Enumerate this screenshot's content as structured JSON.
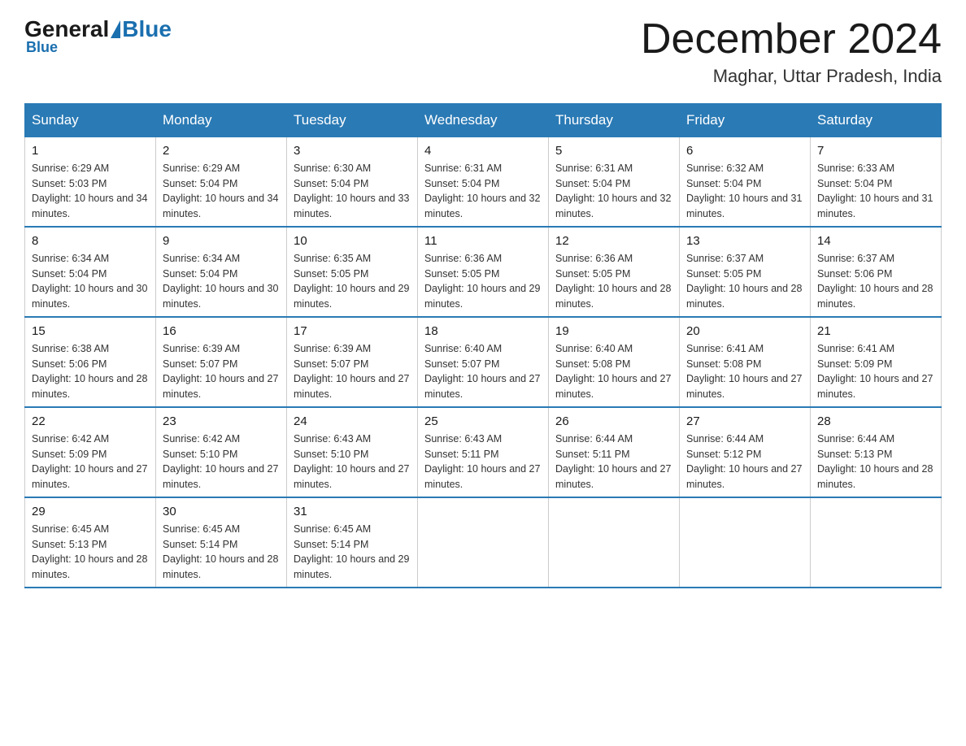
{
  "header": {
    "logo_general": "General",
    "logo_blue": "Blue",
    "month_title": "December 2024",
    "location": "Maghar, Uttar Pradesh, India"
  },
  "days_of_week": [
    "Sunday",
    "Monday",
    "Tuesday",
    "Wednesday",
    "Thursday",
    "Friday",
    "Saturday"
  ],
  "weeks": [
    [
      {
        "day": "1",
        "sunrise": "6:29 AM",
        "sunset": "5:03 PM",
        "daylight": "10 hours and 34 minutes."
      },
      {
        "day": "2",
        "sunrise": "6:29 AM",
        "sunset": "5:04 PM",
        "daylight": "10 hours and 34 minutes."
      },
      {
        "day": "3",
        "sunrise": "6:30 AM",
        "sunset": "5:04 PM",
        "daylight": "10 hours and 33 minutes."
      },
      {
        "day": "4",
        "sunrise": "6:31 AM",
        "sunset": "5:04 PM",
        "daylight": "10 hours and 32 minutes."
      },
      {
        "day": "5",
        "sunrise": "6:31 AM",
        "sunset": "5:04 PM",
        "daylight": "10 hours and 32 minutes."
      },
      {
        "day": "6",
        "sunrise": "6:32 AM",
        "sunset": "5:04 PM",
        "daylight": "10 hours and 31 minutes."
      },
      {
        "day": "7",
        "sunrise": "6:33 AM",
        "sunset": "5:04 PM",
        "daylight": "10 hours and 31 minutes."
      }
    ],
    [
      {
        "day": "8",
        "sunrise": "6:34 AM",
        "sunset": "5:04 PM",
        "daylight": "10 hours and 30 minutes."
      },
      {
        "day": "9",
        "sunrise": "6:34 AM",
        "sunset": "5:04 PM",
        "daylight": "10 hours and 30 minutes."
      },
      {
        "day": "10",
        "sunrise": "6:35 AM",
        "sunset": "5:05 PM",
        "daylight": "10 hours and 29 minutes."
      },
      {
        "day": "11",
        "sunrise": "6:36 AM",
        "sunset": "5:05 PM",
        "daylight": "10 hours and 29 minutes."
      },
      {
        "day": "12",
        "sunrise": "6:36 AM",
        "sunset": "5:05 PM",
        "daylight": "10 hours and 28 minutes."
      },
      {
        "day": "13",
        "sunrise": "6:37 AM",
        "sunset": "5:05 PM",
        "daylight": "10 hours and 28 minutes."
      },
      {
        "day": "14",
        "sunrise": "6:37 AM",
        "sunset": "5:06 PM",
        "daylight": "10 hours and 28 minutes."
      }
    ],
    [
      {
        "day": "15",
        "sunrise": "6:38 AM",
        "sunset": "5:06 PM",
        "daylight": "10 hours and 28 minutes."
      },
      {
        "day": "16",
        "sunrise": "6:39 AM",
        "sunset": "5:07 PM",
        "daylight": "10 hours and 27 minutes."
      },
      {
        "day": "17",
        "sunrise": "6:39 AM",
        "sunset": "5:07 PM",
        "daylight": "10 hours and 27 minutes."
      },
      {
        "day": "18",
        "sunrise": "6:40 AM",
        "sunset": "5:07 PM",
        "daylight": "10 hours and 27 minutes."
      },
      {
        "day": "19",
        "sunrise": "6:40 AM",
        "sunset": "5:08 PM",
        "daylight": "10 hours and 27 minutes."
      },
      {
        "day": "20",
        "sunrise": "6:41 AM",
        "sunset": "5:08 PM",
        "daylight": "10 hours and 27 minutes."
      },
      {
        "day": "21",
        "sunrise": "6:41 AM",
        "sunset": "5:09 PM",
        "daylight": "10 hours and 27 minutes."
      }
    ],
    [
      {
        "day": "22",
        "sunrise": "6:42 AM",
        "sunset": "5:09 PM",
        "daylight": "10 hours and 27 minutes."
      },
      {
        "day": "23",
        "sunrise": "6:42 AM",
        "sunset": "5:10 PM",
        "daylight": "10 hours and 27 minutes."
      },
      {
        "day": "24",
        "sunrise": "6:43 AM",
        "sunset": "5:10 PM",
        "daylight": "10 hours and 27 minutes."
      },
      {
        "day": "25",
        "sunrise": "6:43 AM",
        "sunset": "5:11 PM",
        "daylight": "10 hours and 27 minutes."
      },
      {
        "day": "26",
        "sunrise": "6:44 AM",
        "sunset": "5:11 PM",
        "daylight": "10 hours and 27 minutes."
      },
      {
        "day": "27",
        "sunrise": "6:44 AM",
        "sunset": "5:12 PM",
        "daylight": "10 hours and 27 minutes."
      },
      {
        "day": "28",
        "sunrise": "6:44 AM",
        "sunset": "5:13 PM",
        "daylight": "10 hours and 28 minutes."
      }
    ],
    [
      {
        "day": "29",
        "sunrise": "6:45 AM",
        "sunset": "5:13 PM",
        "daylight": "10 hours and 28 minutes."
      },
      {
        "day": "30",
        "sunrise": "6:45 AM",
        "sunset": "5:14 PM",
        "daylight": "10 hours and 28 minutes."
      },
      {
        "day": "31",
        "sunrise": "6:45 AM",
        "sunset": "5:14 PM",
        "daylight": "10 hours and 29 minutes."
      },
      null,
      null,
      null,
      null
    ]
  ],
  "labels": {
    "sunrise": "Sunrise:",
    "sunset": "Sunset:",
    "daylight": "Daylight:"
  }
}
